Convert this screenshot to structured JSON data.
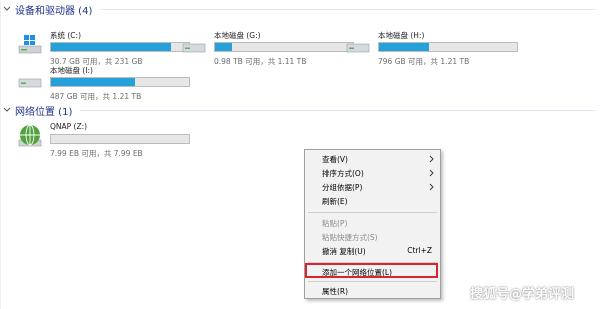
{
  "groups": {
    "devices": "设备和驱动器 (4)",
    "network": "网络位置 (1)"
  },
  "drives": [
    {
      "name": "系统 (C:)",
      "free": "30.7 GB 可用，共 231 GB",
      "used_fraction": 0.87,
      "icon": "windows-system-drive-icon"
    },
    {
      "name": "本地磁盘 (G:)",
      "free": "0.98 TB 可用，共 1.11 TB",
      "used_fraction": 0.12,
      "icon": "hard-drive-icon"
    },
    {
      "name": "本地磁盘 (H:)",
      "free": "796 GB 可用，共 1.21 TB",
      "used_fraction": 0.36,
      "icon": "hard-drive-icon"
    },
    {
      "name": "本地磁盘 (I:)",
      "free": "487 GB 可用，共 1.21 TB",
      "used_fraction": 0.61,
      "icon": "hard-drive-icon"
    }
  ],
  "network_drives": [
    {
      "name": "QNAP (Z:)",
      "free": "7.99 EB 可用，共 7.99 EB",
      "used_fraction": 0.0,
      "icon": "network-globe-icon"
    }
  ],
  "context_menu": {
    "items": [
      {
        "label": "查看(V)",
        "submenu": true
      },
      {
        "label": "排序方式(O)",
        "submenu": true
      },
      {
        "label": "分组依据(P)",
        "submenu": true
      },
      {
        "label": "刷新(E)"
      },
      {
        "label": "粘贴(P)",
        "disabled": true
      },
      {
        "label": "粘贴快捷方式(S)",
        "disabled": true
      },
      {
        "label": "撤消 复制(U)",
        "shortcut": "Ctrl+Z"
      },
      {
        "label": "添加一个网络位置(L)",
        "highlighted": true
      },
      {
        "label": "属性(R)"
      }
    ]
  },
  "watermark": "搜狐号@学弟评测",
  "colors": {
    "group_header": "#1e3287",
    "bar_fill": "#26a0da",
    "highlight_border": "#d8262e"
  }
}
